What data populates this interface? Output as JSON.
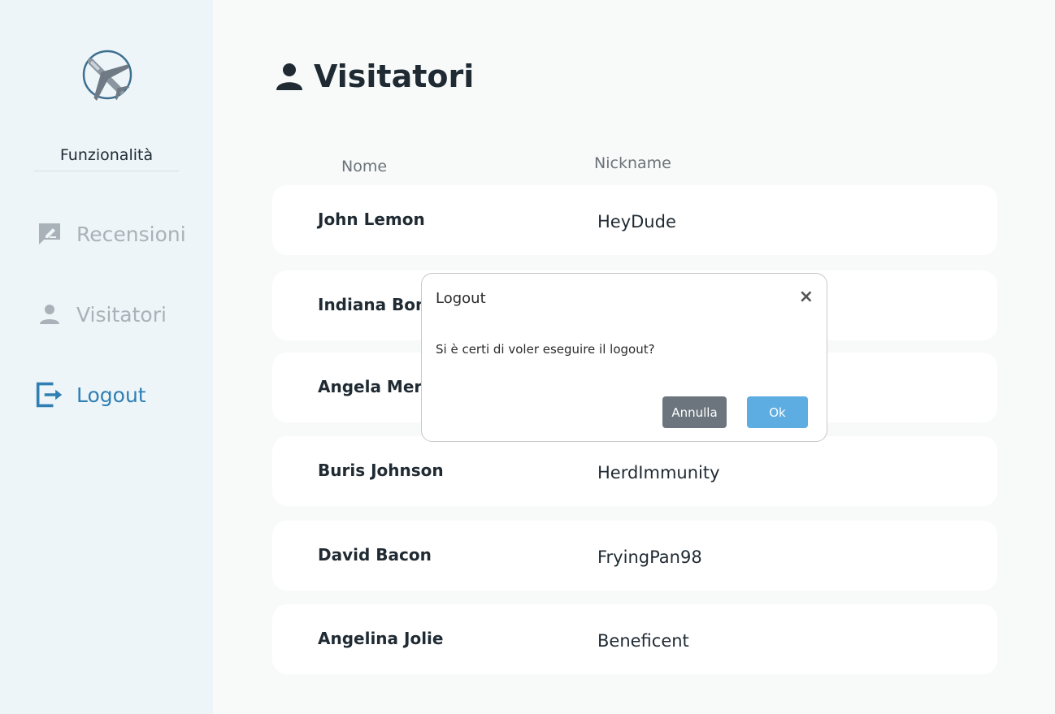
{
  "sidebar": {
    "section_title": "Funzionalità",
    "items": [
      {
        "label": "Recensioni",
        "icon": "review-icon"
      },
      {
        "label": "Visitatori",
        "icon": "person-icon"
      },
      {
        "label": "Logout",
        "icon": "logout-icon"
      }
    ]
  },
  "main": {
    "title": "Visitatori",
    "columns": {
      "name": "Nome",
      "nickname": "Nickname"
    },
    "rows": [
      {
        "name": "John Lemon",
        "nickname": "HeyDude"
      },
      {
        "name": "Indiana Bond",
        "nickname": ""
      },
      {
        "name": "Angela Mer...",
        "nickname": ""
      },
      {
        "name": "Buris Johnson",
        "nickname": "HerdImmunity"
      },
      {
        "name": "David Bacon",
        "nickname": "FryingPan98"
      },
      {
        "name": "Angelina Jolie",
        "nickname": "Beneficent"
      }
    ]
  },
  "modal": {
    "title": "Logout",
    "close": "×",
    "message": "Si è certi di voler eseguire il logout?",
    "cancel_label": "Annulla",
    "ok_label": "Ok"
  },
  "colors": {
    "accent": "#2f7fb4",
    "ok_button": "#5dade2",
    "cancel_button": "#6c757d"
  }
}
